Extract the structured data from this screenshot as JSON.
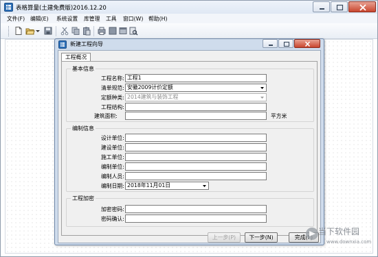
{
  "app": {
    "title": "表格算量(土建免费版)2016.12.20"
  },
  "menu": [
    {
      "label": "文件(F)"
    },
    {
      "label": "编辑(E)"
    },
    {
      "label": "系统设置"
    },
    {
      "label": "库管理"
    },
    {
      "label": "工具"
    },
    {
      "label": "窗口(W)"
    },
    {
      "label": "帮助(H)"
    }
  ],
  "toolbar": {
    "icons": [
      "new-file-icon",
      "open-folder-icon",
      "dropdown-arrow-icon",
      "save-icon",
      "cut-icon",
      "copy-icon",
      "paste-icon",
      "print-icon",
      "layout-icon",
      "window-icon",
      "preview-icon"
    ]
  },
  "dialog": {
    "title": "新建工程向导",
    "tab": "工程概况",
    "basic": {
      "legend": "基本信息",
      "project_name_label": "工程名称:",
      "project_name_value": "工程1",
      "spec_label": "清单规范:",
      "spec_value": "安徽2009计价定额",
      "quota_label": "定额种类:",
      "quota_value": "2014建筑与装饰工程",
      "structure_label": "工程结构:",
      "structure_value": "",
      "area_label": "建筑面积:",
      "area_value": "",
      "area_unit": "平方米"
    },
    "compile": {
      "legend": "编制信息",
      "design_label": "设计单位:",
      "build_label": "建设单位:",
      "construct_label": "施工单位:",
      "compiler_unit_label": "编制单位:",
      "compiler_person_label": "编制人员:",
      "date_label": "编制日期:",
      "date_value": "2018年11月01日"
    },
    "encrypt": {
      "legend": "工程加密",
      "password_label": "加密密码:",
      "confirm_label": "密码确认:"
    },
    "buttons": {
      "prev": "上一步(P)",
      "next": "下一步(N)",
      "finish": "完成(F)"
    }
  },
  "watermark": {
    "text": "当下软件园",
    "url": "www.downxia.com"
  },
  "colors": {
    "titlebar": "#e6edf7",
    "dialog_frame": "#cfdcec",
    "panel": "#f0f0f0"
  }
}
